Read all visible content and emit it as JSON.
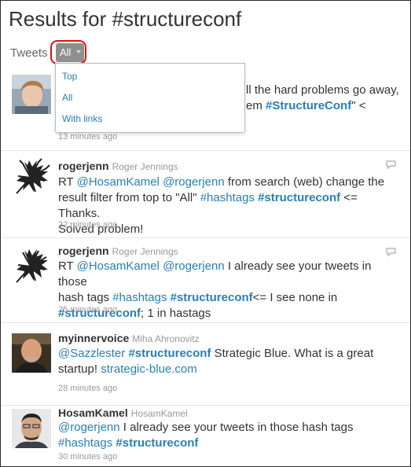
{
  "page": {
    "title": "Results for #structureconf"
  },
  "filter": {
    "label": "Tweets",
    "selected": "All",
    "options": [
      "Top",
      "All",
      "With links"
    ]
  },
  "tweets": [
    {
      "text_visible": [
        "ll the hard problems go away,",
        "em ",
        "#StructureConf",
        "\" <"
      ],
      "time": "13 minutes ago"
    },
    {
      "username": "rogerjenn",
      "fullname": "Roger Jennings",
      "line1": [
        "RT ",
        "@HosamKamel",
        " ",
        "@rogerjenn",
        " from search (web) change the"
      ],
      "line2": [
        "result filter from top to \"All\" ",
        "#hashtags",
        " ",
        "#structureconf",
        " <= Thanks."
      ],
      "line3": "Solved problem!",
      "time": "22 minutes ago"
    },
    {
      "username": "rogerjenn",
      "fullname": "Roger Jennings",
      "line1": [
        "RT ",
        "@HosamKamel",
        " ",
        "@rogerjenn",
        " I already see your tweets in those"
      ],
      "line2": [
        "hash tags ",
        "#hashtags",
        " ",
        "#structureconf",
        "<= I see none in"
      ],
      "line3": [
        "#structureconf",
        "; 1 in hastags"
      ],
      "time": "25 minutes ago"
    },
    {
      "username": "myinnervoice",
      "fullname": "Miha Ahronovitz",
      "line1": [
        "@Sazzlester",
        " ",
        "#structureconf",
        " Strategic Blue. What is a great"
      ],
      "line2": [
        "startup! ",
        "strategic-blue.com"
      ],
      "time": "28 minutes ago"
    },
    {
      "username": "HosamKamel",
      "fullname": "HosamKamel",
      "line1": [
        "@rogerjenn",
        " I already see your tweets in those hash tags"
      ],
      "line2": [
        "#hashtags",
        " ",
        "#structureconf"
      ],
      "time": "30 minutes ago"
    }
  ],
  "icons": {
    "reply": "reply-icon",
    "caret": "caret-down-icon"
  },
  "colors": {
    "link": "#2a7fb3",
    "highlight": "#e01010",
    "button": "#8f8f8f"
  }
}
